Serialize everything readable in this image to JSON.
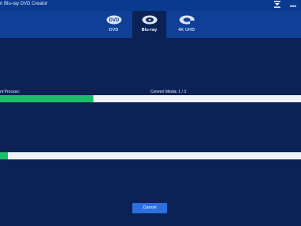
{
  "window": {
    "title": "n Blu-ray DVD Creator"
  },
  "tabs": [
    {
      "label": "DVD",
      "icon": "dvd-logo-icon",
      "active": false
    },
    {
      "label": "Blu-ray",
      "icon": "bluray-logo-icon",
      "active": true
    },
    {
      "label": "4K UHD",
      "icon": "uhd-bluray-logo-icon",
      "active": false
    }
  ],
  "progress": {
    "current_label": "nt Process:",
    "media_text": "Convert Media:  1 / 3",
    "current_fraction": 0.31,
    "total_fraction": 0.025
  },
  "footer": {
    "cancel_label": "Cancel"
  },
  "colors": {
    "titlebar": "#0a3a8e",
    "tabbar": "#0f3f96",
    "background": "#0c2254",
    "progress_fill": "#1bbf6b",
    "progress_track": "#eef3fb",
    "button": "#2b6fe0"
  }
}
